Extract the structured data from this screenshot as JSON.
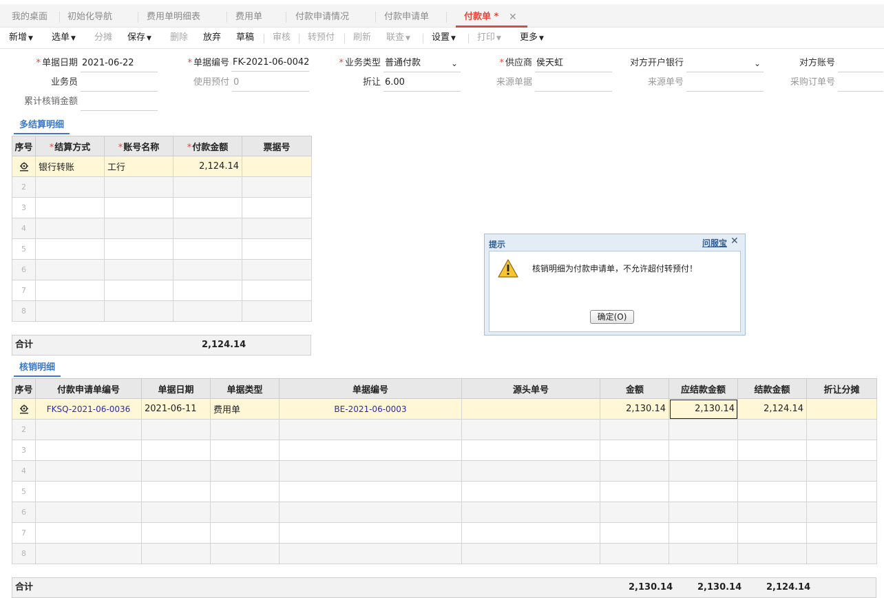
{
  "tabs": [
    {
      "label": "我的桌面"
    },
    {
      "label": "初始化导航"
    },
    {
      "label": "费用单明细表"
    },
    {
      "label": "费用单"
    },
    {
      "label": "付款申请情况"
    },
    {
      "label": "付款申请单"
    },
    {
      "label": "付款单 *",
      "active": true
    }
  ],
  "toolbar": {
    "add": "新增",
    "select_bill": "选单",
    "allocate": "分摊",
    "save": "保存",
    "delete": "删除",
    "abandon": "放弃",
    "draft": "草稿",
    "audit": "审核",
    "to_prepay": "转预付",
    "refresh": "刷新",
    "linked_query": "联查",
    "settings": "设置",
    "print": "打印",
    "more": "更多"
  },
  "form": {
    "bill_date": {
      "label": "单据日期",
      "value": "2021-06-22"
    },
    "bill_no": {
      "label": "单据编号",
      "value": "FK-2021-06-0042"
    },
    "biz_type": {
      "label": "业务类型",
      "value": "普通付款"
    },
    "supplier": {
      "label": "供应商",
      "value": "侯天虹"
    },
    "peer_bank": {
      "label": "对方开户银行",
      "value": ""
    },
    "peer_account": {
      "label": "对方账号",
      "value": ""
    },
    "clerk": {
      "label": "业务员",
      "value": ""
    },
    "use_prepay": {
      "label": "使用预付",
      "value": "0"
    },
    "discount": {
      "label": "折让",
      "value": "6.00"
    },
    "source_doc": {
      "label": "来源单据",
      "value": ""
    },
    "source_no": {
      "label": "来源单号",
      "value": ""
    },
    "po_no": {
      "label": "采购订单号",
      "value": ""
    },
    "total_writeoff": {
      "label": "累计核销金额",
      "value": ""
    }
  },
  "settlement": {
    "title": "多结算明细",
    "headers": {
      "idx": "序号",
      "method": "结算方式",
      "account": "账号名称",
      "amount": "付款金额",
      "ticket": "票据号"
    },
    "rows": [
      {
        "method": "银行转账",
        "account": "工行",
        "amount": "2,124.14",
        "ticket": ""
      }
    ],
    "blank_rows": [
      "2",
      "3",
      "4",
      "5",
      "6",
      "7",
      "8"
    ],
    "sum_label": "合计",
    "sum_amount": "2,124.14"
  },
  "writeoff": {
    "title": "核销明细",
    "headers": {
      "idx": "序号",
      "req_no": "付款申请单编号",
      "date": "单据日期",
      "type": "单据类型",
      "bill_no": "单据编号",
      "src_no": "源头单号",
      "amount": "金额",
      "payable": "应结款金额",
      "settle": "结款金额",
      "discount": "折让分摊"
    },
    "rows": [
      {
        "req_no": "FKSQ-2021-06-0036",
        "date": "2021-06-11",
        "type": "费用单",
        "bill_no": "BE-2021-06-0003",
        "src_no": "",
        "amount": "2,130.14",
        "payable": "2,130.14",
        "settle": "2,124.14",
        "discount": ""
      }
    ],
    "blank_rows": [
      "2",
      "3",
      "4",
      "5",
      "6",
      "7",
      "8"
    ],
    "sum_label": "合计",
    "sum_amount": "2,130.14",
    "sum_payable": "2,130.14",
    "sum_settle": "2,124.14"
  },
  "dialog": {
    "title": "提示",
    "help": "问服宝",
    "message": "核销明细为付款申请单，不允许超付转预付！",
    "ok": "确定(O)"
  },
  "colors": {
    "accent": "#e0483d",
    "section": "#3a78c9",
    "selected_row": "#fff7d6",
    "link": "#2a2ab0"
  }
}
